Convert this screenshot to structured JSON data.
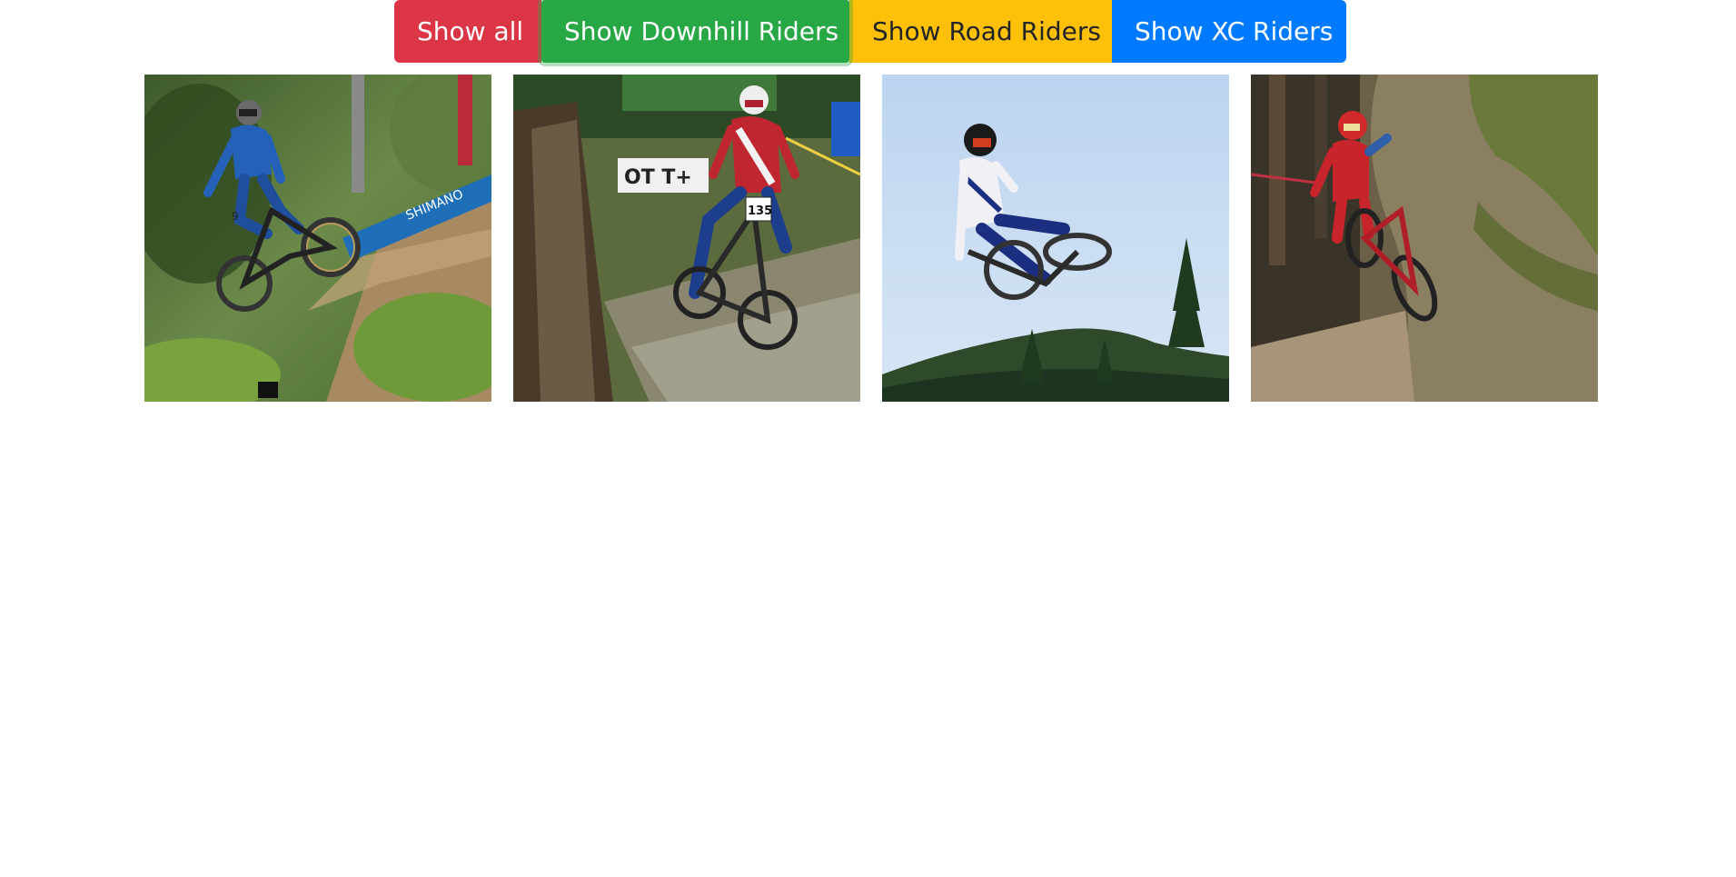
{
  "filters": {
    "show_all": "Show all",
    "show_downhill": "Show Downhill Riders",
    "show_road": "Show Road Riders",
    "show_xc": "Show XC Riders"
  },
  "colors": {
    "show_all": "#dc3545",
    "show_downhill": "#28a745",
    "show_road": "#ffc107",
    "show_xc": "#007bff"
  },
  "gallery": {
    "photo_1": {
      "bib": "9",
      "banner": "SHIMANO"
    },
    "photo_2": {
      "bib": "135",
      "sign": "OT T+"
    },
    "photo_3": {},
    "photo_4": {}
  }
}
